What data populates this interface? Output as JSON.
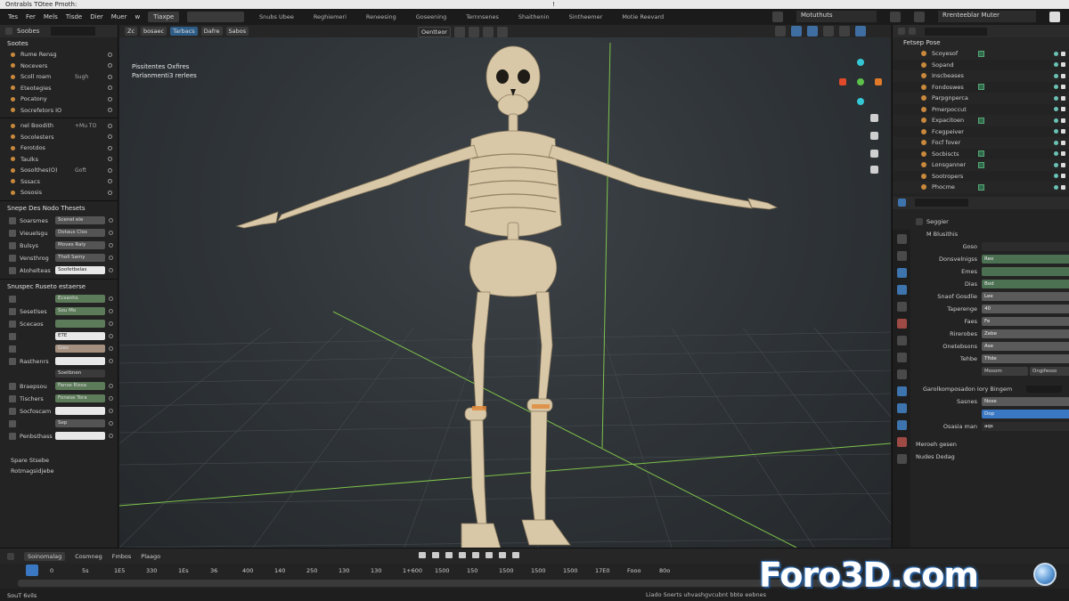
{
  "window": {
    "title": "Ontrabls TOtee Pmoth:"
  },
  "menu": {
    "items": [
      "Tes",
      "Fer",
      "Mels",
      "Tisde",
      "Dier",
      "Muer",
      "w"
    ],
    "active": "Tiaxpe",
    "workspace_field": "",
    "workspaces": [
      "Snubs Ubee",
      "Reghiemeri",
      "Reneesing",
      "Goseening",
      "Ternnsenes",
      "Shaithenin",
      "Sintheemer",
      "Motie Reevard"
    ]
  },
  "top_right": {
    "scene": "Motuthuts",
    "view_layer": "Rrenteeblar Muter"
  },
  "left_panel": {
    "header": "Soobes",
    "section_title": "Sootes",
    "rows_a": [
      {
        "label": "Rume Rensg",
        "sub": ""
      },
      {
        "label": "Nocevers",
        "sub": ""
      },
      {
        "label": "Scoll roam",
        "sub": "Sugh"
      },
      {
        "label": "Eteotegies",
        "sub": ""
      },
      {
        "label": "Pocatony",
        "sub": ""
      },
      {
        "label": "Socrefetors IO",
        "sub": ""
      }
    ],
    "rows_b": [
      {
        "label": "nel Boodith",
        "sub": "+Mu TO"
      },
      {
        "label": "Socolesters",
        "sub": ""
      },
      {
        "label": "Ferotdos",
        "sub": ""
      },
      {
        "label": "Taulks",
        "sub": ""
      },
      {
        "label": "Sosolthes(O)",
        "sub": "Goft"
      },
      {
        "label": "Sssacs",
        "sub": ""
      },
      {
        "label": "Sososis",
        "sub": ""
      }
    ],
    "props_title": "Snepe Des Nodo Thesets",
    "props_a": [
      {
        "label": "Soarsmes",
        "value": "Scenel ele",
        "style": ""
      },
      {
        "label": "Vieuelsgu",
        "value": "Dotaus Clos",
        "style": ""
      },
      {
        "label": "Bulsys",
        "value": "Moves Raly",
        "style": ""
      },
      {
        "label": "Vensthrog",
        "value": "Tholl Samy",
        "style": ""
      },
      {
        "label": "Atohelteas",
        "value": "Soofetbelas",
        "style": "white"
      }
    ],
    "props_title_2": "Snuspec Ruseto estaerse",
    "props_b": [
      {
        "label": "",
        "value": "Ecsanhs",
        "style": "green"
      },
      {
        "label": "Sesetlses",
        "value": "Sou Mo",
        "style": "green"
      },
      {
        "label": "Scecaos",
        "value": "",
        "style": "green"
      },
      {
        "label": "",
        "value": "ETE",
        "style": "white"
      },
      {
        "label": "",
        "value": "Gies",
        "style": "orange"
      },
      {
        "label": "Rasthenrs",
        "value": "",
        "style": "white"
      }
    ],
    "props_c_title": "Soetbnen",
    "props_c": [
      {
        "label": "Braepsou",
        "value": "Fanse Rissa",
        "style": "green"
      },
      {
        "label": "Tischers",
        "value": "Fonese Tora",
        "style": "green"
      },
      {
        "label": "Socfoscam",
        "value": "",
        "style": "white"
      },
      {
        "label": "",
        "value": "Sep",
        "style": ""
      },
      {
        "label": "Penbsthass",
        "value": "",
        "style": "white"
      }
    ],
    "footer": [
      "Spare Stsebe",
      "Rotmagsidjebe"
    ]
  },
  "viewport": {
    "header_chips": [
      "Zc",
      "bosaec",
      "Tarbacs",
      "Dafre",
      "Sabos"
    ],
    "mid_chip": "Oentteor",
    "info_lines": [
      "Pissitentes Oxfires",
      "Parlanmenti3 rerlees"
    ]
  },
  "right_panel": {
    "outliner_title": "Fetsep Pose",
    "outliner_rows": [
      "Scoyesof",
      "Sopand",
      "Inscbeases",
      "Fondoswes",
      "Parpgnperca",
      "Pmerpoccut",
      "Expacitoen",
      "Fcegpeiver",
      "Focf fover",
      "Socbiscts",
      "Lonsganner",
      "Sootropers",
      "Phocme"
    ],
    "props_head": "Seggier",
    "props_sub": "M Blusithis",
    "props": [
      {
        "label": "Goso",
        "value": "",
        "style": "dark"
      },
      {
        "label": "Donsvelnigss",
        "value": "Reo",
        "style": "green"
      },
      {
        "label": "Emes",
        "value": "",
        "style": "green"
      },
      {
        "label": "Dias",
        "value": "Bod",
        "style": "green"
      },
      {
        "label": "Snaof Gosdlie",
        "value": "Lee",
        "style": "grey"
      },
      {
        "label": "Taperenge",
        "value": "40",
        "style": "grey"
      },
      {
        "label": "Faes",
        "value": "Fe",
        "style": "grey"
      },
      {
        "label": "Rirerobes",
        "value": "Zebe",
        "style": "grey"
      },
      {
        "label": "Onetebsons",
        "value": "Ase",
        "style": "grey"
      },
      {
        "label": "Tehbe",
        "value": "Tfide",
        "style": "grey"
      }
    ],
    "buttons": [
      "Mosom",
      "Ongifesso"
    ],
    "group_title": "Garolkomposadon Iory Bingem",
    "group_rows": [
      {
        "label": "Sasnes",
        "value": "Nose",
        "style": "grey"
      },
      {
        "label": "",
        "value": "Dop",
        "style": "blue"
      },
      {
        "label": "Osasia man",
        "value": "aqs",
        "style": "dark"
      }
    ],
    "footer": [
      "Meroeh gesen",
      "Nudes Dedag"
    ]
  },
  "timeline": {
    "tabs": [
      "Soinomalag",
      "Cosmneg",
      "Fmbos",
      "Plaago"
    ],
    "frames": [
      "0",
      "5s",
      "1E5",
      "330",
      "1Es",
      "36",
      "400",
      "140",
      "250",
      "130",
      "130",
      "1+600",
      "1500",
      "150",
      "1500",
      "1500",
      "1500",
      "17E0",
      "Fooo",
      "80o"
    ],
    "status": "SouT 6vils",
    "status_right": "Liado Soerts uhvashgvcubnt bbte eebnes"
  },
  "watermark": "Foro3D.com"
}
